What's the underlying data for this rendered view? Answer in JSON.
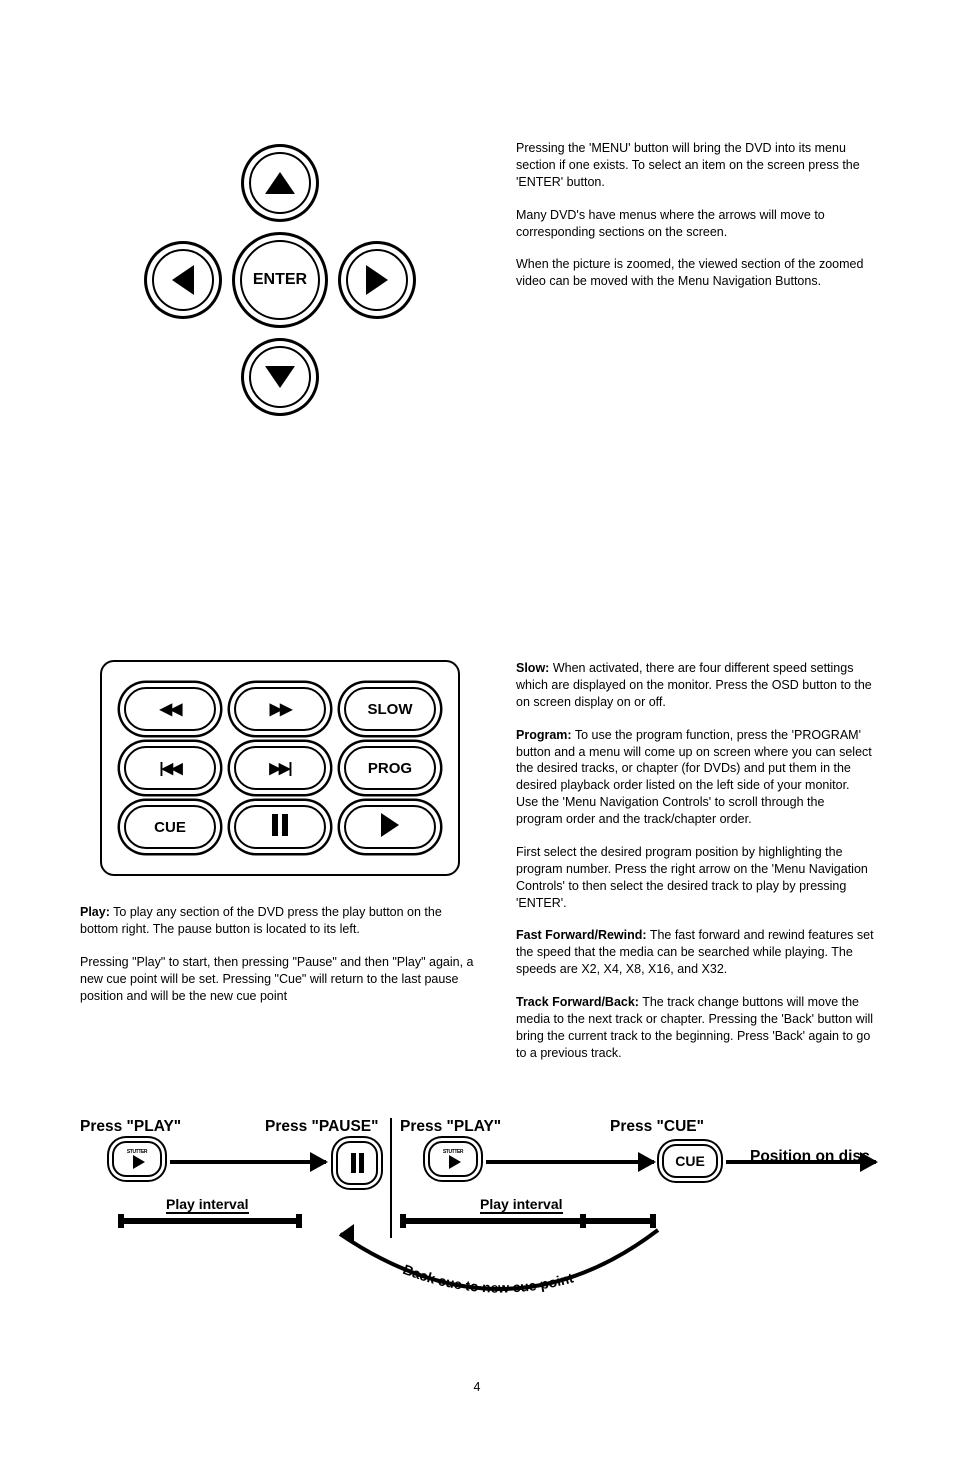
{
  "menu_nav": {
    "center_label": "ENTER",
    "para1": "Pressing the 'MENU' button will bring the DVD into its menu section if one exists.  To select an item on the screen press the 'ENTER' button.",
    "para2": "Many DVD's have menus where the arrows will move to corresponding sections on the screen.",
    "para3": "When the picture is zoomed, the viewed section of the zoomed video can be moved with the Menu Navigation Buttons."
  },
  "transport": {
    "slow_label": "SLOW",
    "prog_label": "PROG",
    "cue_label": "CUE"
  },
  "left_text": {
    "play_lead": "Play:",
    "play_body": "  To play any section of the DVD press the play button on the bottom right.  The pause button is located to its left.",
    "cue_body": "Pressing \"Play\" to start, then pressing \"Pause\" and then \"Play\" again, a new cue point will be set.  Pressing \"Cue\" will return to the last pause position and will be the new cue point"
  },
  "right_text": {
    "slow_lead": "Slow:",
    "slow_body": "  When activated, there are four different speed settings which are displayed on the monitor.  Press the OSD button to the on screen display on or off.",
    "prog_lead": "Program:",
    "prog_body": "  To use the program function, press the 'PROGRAM' button and a menu will come up on screen where you can select the desired tracks, or chapter (for DVDs) and put them in the desired playback order listed on the left side of your monitor.  Use the 'Menu Navigation Controls' to scroll through the program order and the track/chapter order.",
    "prog_para2": "First select the desired program position by highlighting the program number.  Press the right arrow on the 'Menu Navigation Controls' to then select the desired track to play by pressing 'ENTER'.",
    "ffrw_lead": "Fast Forward/Rewind:",
    "ffrw_body": "  The fast forward and rewind features set the speed that the media can be searched while playing.  The speeds are X2, X4, X8, X16, and X32.",
    "track_lead": "Track Forward/Back:",
    "track_body": "  The track change buttons will move the media to the next track or chapter.  Pressing the 'Back' button will bring the current track to the beginning.  Press 'Back' again to go to a previous track."
  },
  "timeline": {
    "press_play": "Press \"PLAY\"",
    "press_pause": "Press \"PAUSE\"",
    "press_play2": "Press \"PLAY\"",
    "press_cue": "Press \"CUE\"",
    "position": "Position on disc",
    "stutter": "STUTTER",
    "cue_btn": "CUE",
    "interval": "Play interval",
    "interval2": "Play interval",
    "curve": "Back cue to new cue point"
  },
  "page_number": "4"
}
